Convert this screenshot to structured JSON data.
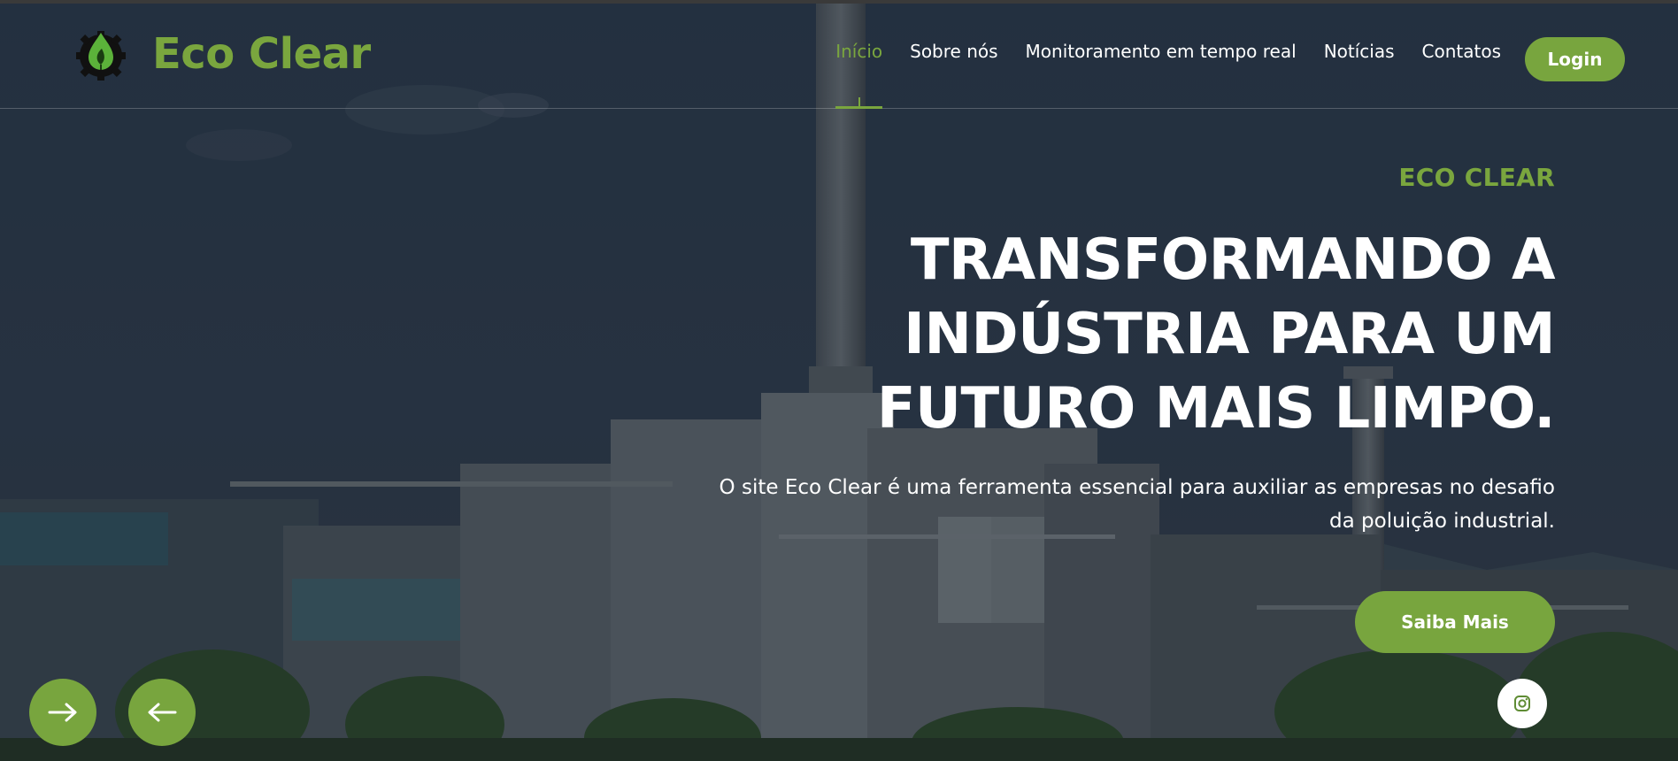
{
  "brand": {
    "name": "Eco Clear",
    "logo_icon": "leaf-drop-gear-icon",
    "accent_color": "#7aa63e"
  },
  "nav": {
    "items": [
      {
        "label": "Início",
        "active": true
      },
      {
        "label": "Sobre nós",
        "active": false
      },
      {
        "label": "Monitoramento em tempo real",
        "active": false
      },
      {
        "label": "Notícias",
        "active": false
      },
      {
        "label": "Contatos",
        "active": false
      }
    ],
    "login_label": "Login"
  },
  "hero": {
    "kicker": "ECO CLEAR",
    "headline_lines": [
      "TRANSFORMANDO A",
      "INDÚSTRIA PARA UM",
      "FUTURO MAIS LIMPO."
    ],
    "description": "O site Eco Clear é uma ferramenta essencial para auxiliar as empresas no desafio da poluição industrial.",
    "cta_label": "Saiba Mais",
    "background_scene": "industrial-plant-photo"
  },
  "carousel": {
    "next_icon": "arrow-right-icon",
    "prev_icon": "arrow-left-icon"
  },
  "social": {
    "icon": "instagram-icon"
  },
  "colors": {
    "accent": "#78a53e",
    "text_light": "#ffffff"
  }
}
